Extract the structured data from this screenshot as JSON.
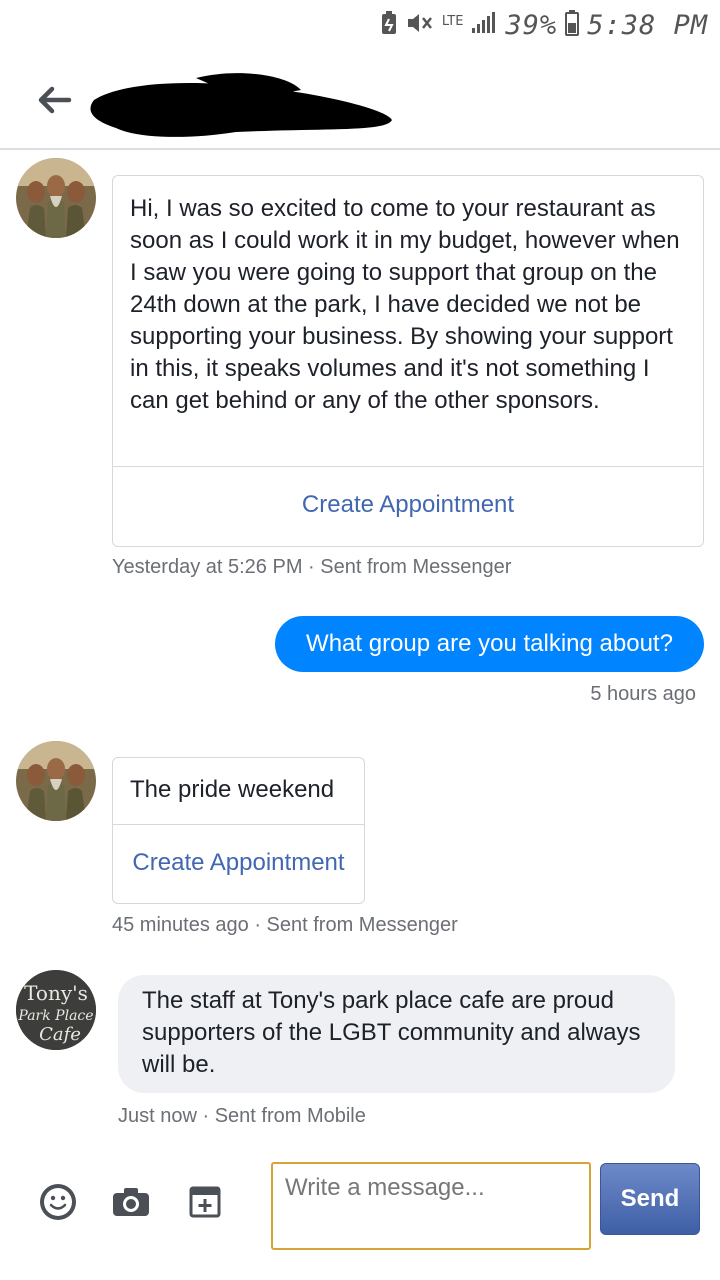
{
  "status_bar": {
    "network": "LTE",
    "battery": "39%",
    "time": "5:38 PM"
  },
  "header": {
    "back_icon": "arrow-left-icon",
    "contact_name_redacted": true
  },
  "messages": [
    {
      "from": "customer",
      "avatar": "customer-avatar",
      "text": "Hi, I was so excited to come to your restaurant as soon as I could work it in my budget, however when I saw you were going to support that group on the 24th down at the park, I have decided we not be supporting your business. By showing your support in this, it speaks volumes and it's not something I can get behind or any of the other sponsors.",
      "action_label": "Create Appointment",
      "meta": "Yesterday at 5:26 PM · Sent from Messenger"
    },
    {
      "from": "page",
      "text": "What group are you talking about?",
      "meta": "5 hours ago"
    },
    {
      "from": "customer",
      "avatar": "customer-avatar",
      "text": "The pride weekend",
      "action_label": "Create Appointment",
      "meta": "45 minutes ago · Sent from Messenger"
    },
    {
      "from": "page",
      "avatar": "tonys-logo-avatar",
      "avatar_text": [
        "Tony's",
        "Park Place",
        "Cafe"
      ],
      "text": "The staff at Tony's park place cafe are proud supporters of the LGBT community and always will be.",
      "meta": "Just now · Sent from Mobile"
    }
  ],
  "composer": {
    "placeholder": "Write a message...",
    "send_label": "Send",
    "icons": [
      "emoji-icon",
      "camera-icon",
      "add-calendar-icon"
    ]
  },
  "colors": {
    "outgoing_bubble": "#0084ff",
    "link": "#4267b2",
    "input_border": "#d4a437",
    "send_button": "#4b67a8"
  }
}
